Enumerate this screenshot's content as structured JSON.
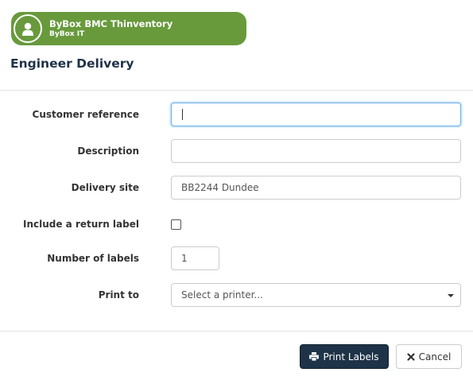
{
  "header": {
    "app_name": "ByBox BMC Thinventory",
    "org_name": "ByBox IT",
    "avatar_icon": "user-icon",
    "brand_color": "#689a3c"
  },
  "page": {
    "title": "Engineer Delivery"
  },
  "form": {
    "customer_reference": {
      "label": "Customer reference",
      "value": "",
      "focused": true
    },
    "description": {
      "label": "Description",
      "value": ""
    },
    "delivery_site": {
      "label": "Delivery site",
      "value": "BB2244 Dundee"
    },
    "include_return_label": {
      "label": "Include a return label",
      "checked": false
    },
    "number_of_labels": {
      "label": "Number of labels",
      "value": "1"
    },
    "print_to": {
      "label": "Print to",
      "selected": "Select a printer..."
    }
  },
  "footer": {
    "print_label": "Print Labels",
    "print_icon": "printer-icon",
    "cancel_label": "Cancel",
    "cancel_icon": "close-icon",
    "primary_color": "#1e3347"
  }
}
